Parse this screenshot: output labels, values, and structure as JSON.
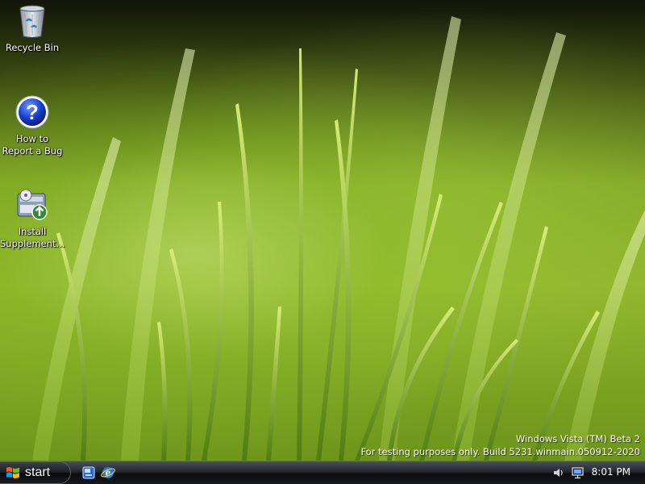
{
  "desktop": {
    "icons": [
      {
        "label": "Recycle Bin",
        "icon": "recycle-bin-icon"
      },
      {
        "label": "How to\nReport a Bug",
        "icon": "question-help-icon"
      },
      {
        "label": "Install\nSupplement...",
        "icon": "installer-icon"
      }
    ],
    "watermark": {
      "line1": "Windows Vista (TM) Beta 2",
      "line2": "For testing purposes only. Build 5231.winmain.050912-2020"
    }
  },
  "taskbar": {
    "start_label": "start",
    "quick_launch": [
      {
        "icon": "show-desktop-icon"
      },
      {
        "icon": "internet-explorer-icon"
      }
    ],
    "tray": {
      "icons": [
        "volume-icon",
        "network-icon"
      ],
      "clock": "8:01 PM"
    }
  },
  "colors": {
    "taskbar_top": "#4a4f58",
    "taskbar_bottom": "#0b0c0f",
    "help_blue": "#1a3fd0",
    "ie_blue": "#1c7de0"
  }
}
